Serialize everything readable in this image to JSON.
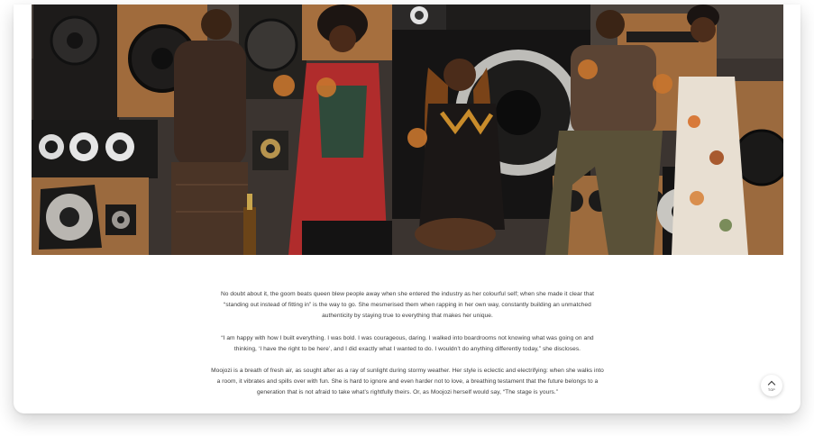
{
  "hero": {
    "image_alt": "Group of five people in stylish outfits toasting with glasses in front of a wall of vintage speakers"
  },
  "article": {
    "paragraphs": [
      "No doubt about it, the goom beats queen blew people away when she entered the industry as her colourful self; when she made it clear that “standing out instead of fitting in” is the way to go. She mesmerised them when rapping in her own way, constantly building an unmatched authenticity by staying true to everything that makes her unique.",
      "“I am happy with how I built everything. I was bold. I was courageous, daring. I walked into boardrooms not knowing what was going on and thinking, ‘I have the right to be here’, and I did exactly what I wanted to do. I wouldn’t do anything differently today,” she discloses.",
      "Moojozi is a breath of fresh air, as sought after as a ray of sunlight during stormy weather. Her style is eclectic and electrifying: when she walks into a room, it vibrates and spills over with fun. She is hard to ignore and even harder not to love, a breathing testament that the future belongs to a generation that is not afraid to take what’s rightfully theirs. Or, as Moojozi herself would say, “The stage is yours.”"
    ]
  },
  "scroll_top": {
    "label": "TOP",
    "icon": "chevron-up-icon"
  },
  "colors": {
    "text": "#3a3a3a",
    "background": "#ffffff"
  }
}
